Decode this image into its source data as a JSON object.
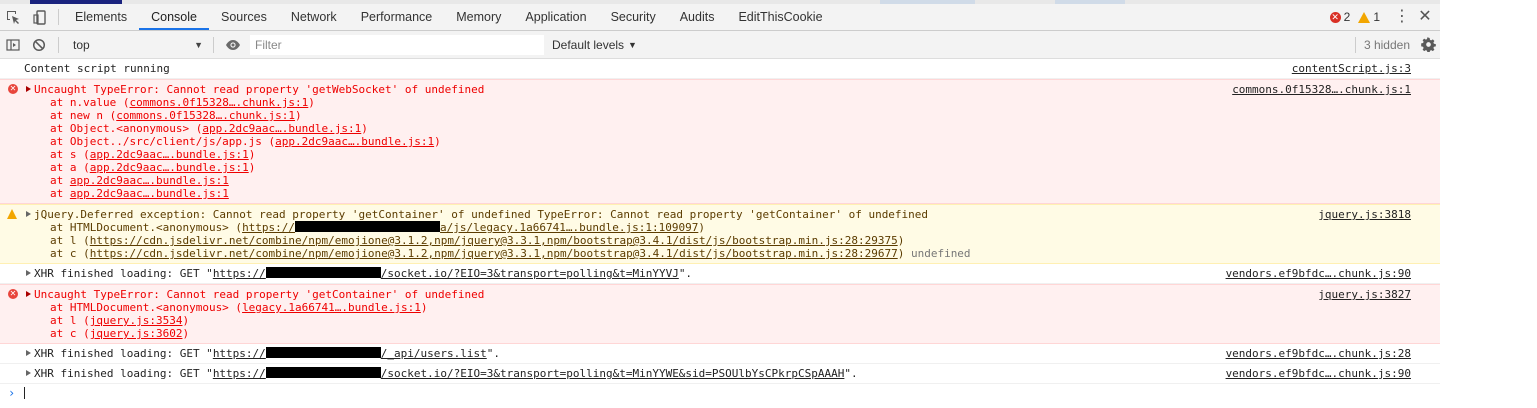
{
  "tabs": [
    "Elements",
    "Console",
    "Sources",
    "Network",
    "Performance",
    "Memory",
    "Application",
    "Security",
    "Audits",
    "EditThisCookie"
  ],
  "active_tab": "Console",
  "counts": {
    "errors": "2",
    "warnings": "1"
  },
  "toolbar": {
    "context": "top",
    "filter_placeholder": "Filter",
    "levels": "Default levels",
    "hidden": "3 hidden"
  },
  "messages": [
    {
      "level": "info",
      "expandable": false,
      "text": "Content script running",
      "source": "contentScript.js:3",
      "stack": []
    },
    {
      "level": "error",
      "expandable": true,
      "text": "Uncaught TypeError: Cannot read property 'getWebSocket' of undefined",
      "source": "commons.0f15328….chunk.js:1",
      "stack": [
        [
          {
            "t": "at n.value ("
          },
          {
            "t": "commons.0f15328….chunk.js:1",
            "link": true
          },
          {
            "t": ")"
          }
        ],
        [
          {
            "t": "at new n ("
          },
          {
            "t": "commons.0f15328….chunk.js:1",
            "link": true
          },
          {
            "t": ")"
          }
        ],
        [
          {
            "t": "at Object.<anonymous> ("
          },
          {
            "t": "app.2dc9aac….bundle.js:1",
            "link": true
          },
          {
            "t": ")"
          }
        ],
        [
          {
            "t": "at Object../src/client/js/app.js ("
          },
          {
            "t": "app.2dc9aac….bundle.js:1",
            "link": true
          },
          {
            "t": ")"
          }
        ],
        [
          {
            "t": "at s ("
          },
          {
            "t": "app.2dc9aac….bundle.js:1",
            "link": true
          },
          {
            "t": ")"
          }
        ],
        [
          {
            "t": "at a ("
          },
          {
            "t": "app.2dc9aac….bundle.js:1",
            "link": true
          },
          {
            "t": ")"
          }
        ],
        [
          {
            "t": "at "
          },
          {
            "t": "app.2dc9aac….bundle.js:1",
            "link": true
          }
        ],
        [
          {
            "t": "at "
          },
          {
            "t": "app.2dc9aac….bundle.js:1",
            "link": true
          }
        ]
      ]
    },
    {
      "level": "warning",
      "expandable": true,
      "text": "jQuery.Deferred exception: Cannot read property 'getContainer' of undefined TypeError: Cannot read property 'getContainer' of undefined",
      "source": "jquery.js:3818",
      "stack": [
        [
          {
            "t": "at HTMLDocument.<anonymous> ("
          },
          {
            "t": "https://",
            "link": true
          },
          {
            "redact": "w145"
          },
          {
            "t": "a/js/legacy.1a66741….bundle.js:1:109097",
            "link": true
          },
          {
            "t": ")"
          }
        ],
        [
          {
            "t": "at l ("
          },
          {
            "t": "https://cdn.jsdelivr.net/combine/npm/emojione@3.1.2,npm/jquery@3.3.1,npm/bootstrap@3.4.1/dist/js/bootstrap.min.js:28:29375",
            "link": true
          },
          {
            "t": ")"
          }
        ],
        [
          {
            "t": "at c ("
          },
          {
            "t": "https://cdn.jsdelivr.net/combine/npm/emojione@3.1.2,npm/jquery@3.3.1,npm/bootstrap@3.4.1/dist/js/bootstrap.min.js:28:29677",
            "link": true
          },
          {
            "t": ") "
          },
          {
            "t": "undefined",
            "cls": "undef"
          }
        ]
      ]
    },
    {
      "level": "info",
      "expandable": true,
      "text": [
        {
          "t": "XHR finished loading: GET \""
        },
        {
          "t": "https://",
          "link": true
        },
        {
          "redact": "w115"
        },
        {
          "t": "/socket.io/?EIO=3&transport=polling&t=MinYYVJ",
          "link": true
        },
        {
          "t": "\"."
        }
      ],
      "source": "vendors.ef9bfdc….chunk.js:90",
      "stack": []
    },
    {
      "level": "error",
      "expandable": true,
      "text": "Uncaught TypeError: Cannot read property 'getContainer' of undefined",
      "source": "jquery.js:3827",
      "stack": [
        [
          {
            "t": "at HTMLDocument.<anonymous> ("
          },
          {
            "t": "legacy.1a66741….bundle.js:1",
            "link": true
          },
          {
            "t": ")"
          }
        ],
        [
          {
            "t": "at l ("
          },
          {
            "t": "jquery.js:3534",
            "link": true
          },
          {
            "t": ")"
          }
        ],
        [
          {
            "t": "at c ("
          },
          {
            "t": "jquery.js:3602",
            "link": true
          },
          {
            "t": ")"
          }
        ]
      ]
    },
    {
      "level": "info",
      "expandable": true,
      "text": [
        {
          "t": "XHR finished loading: GET \""
        },
        {
          "t": "https://",
          "link": true
        },
        {
          "redact": "w115"
        },
        {
          "t": "/_api/users.list",
          "link": true
        },
        {
          "t": "\"."
        }
      ],
      "source": "vendors.ef9bfdc….chunk.js:28",
      "stack": []
    },
    {
      "level": "info",
      "expandable": true,
      "text": [
        {
          "t": "XHR finished loading: GET \""
        },
        {
          "t": "https://",
          "link": true
        },
        {
          "redact": "w115"
        },
        {
          "t": "/socket.io/?EIO=3&transport=polling&t=MinYYWE&sid=PSOUlbYsCPkrpCSpAAAH",
          "link": true
        },
        {
          "t": "\"."
        }
      ],
      "source": "vendors.ef9bfdc….chunk.js:90",
      "stack": []
    }
  ]
}
